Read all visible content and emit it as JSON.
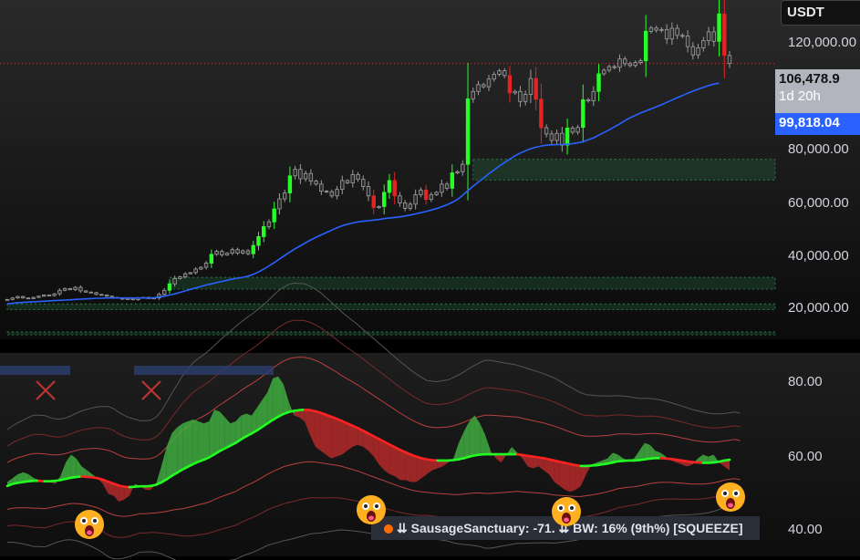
{
  "currency_label": "USDT",
  "price_tag": {
    "price": "106,478.9",
    "timer": "1d 20h"
  },
  "ma_tag": {
    "value": "99,818.04"
  },
  "legend": {
    "text": "⇊ SausageSanctuary: -71.  ⇊ BW: 16% (9th%) [SQUEEZE]"
  },
  "colors": {
    "bull_candle": "#26ff26",
    "bear_candle": "#e52323",
    "neutral_candle": "#9e9e9e",
    "blue_candle": "#2140d8",
    "ma_line": "#2962ff",
    "osc_up": "#3fae3f",
    "osc_down": "#b52a2a",
    "signal_up": "#22ff22",
    "signal_down": "#ff2222"
  },
  "chart_data": [
    {
      "type": "candlestick",
      "y_axis": {
        "ticks": [
          "120,000.00",
          "80,000.00",
          "60,000.00",
          "40,000.00",
          "20,000.00"
        ],
        "tick_values": [
          120000,
          80000,
          60000,
          40000,
          20000
        ],
        "range": [
          13000,
          128000
        ]
      },
      "current_price": 106478.9,
      "moving_average_last": 99818.04,
      "close_series": [
        26500,
        27000,
        27500,
        27000,
        26800,
        27200,
        27600,
        28000,
        27800,
        28400,
        29600,
        30200,
        29800,
        30600,
        29400,
        29000,
        28800,
        28200,
        28000,
        27600,
        27200,
        27000,
        26600,
        26800,
        26400,
        27000,
        27200,
        26800,
        27000,
        28200,
        29600,
        31800,
        33600,
        34200,
        35200,
        35600,
        36800,
        37400,
        38800,
        41800,
        42800,
        41600,
        42200,
        43400,
        42200,
        43000,
        42000,
        44800,
        47800,
        51200,
        52800,
        57200,
        60600,
        62600,
        68400,
        70600,
        67400,
        69200,
        66600,
        65600,
        63200,
        63000,
        61600,
        63800,
        66800,
        66000,
        68800,
        67200,
        64800,
        61600,
        57600,
        58000,
        62800,
        66800,
        61600,
        59200,
        57400,
        58800,
        62000,
        63600,
        60400,
        62000,
        62800,
        65600,
        64200,
        69400,
        69800,
        72300,
        94500,
        97000,
        99300,
        98600,
        101200,
        102800,
        104000,
        102400,
        96500,
        97000,
        93600,
        96000,
        101400,
        94400,
        84700,
        82600,
        80400,
        82800,
        78800,
        84600,
        83200,
        84800,
        94200,
        93800,
        97000,
        103000,
        104200,
        105400,
        105200,
        108000,
        106400,
        105800,
        106800,
        107400,
        117400,
        118500,
        117800,
        118000,
        114800,
        118400,
        116000,
        115800,
        112200,
        109400,
        111800,
        114200,
        117200,
        114000,
        123300,
        109200,
        106478.9
      ],
      "ma_series": [
        25000,
        25200,
        25400,
        25500,
        25600,
        25700,
        25800,
        25900,
        26000,
        26100,
        26200,
        26300,
        26400,
        26500,
        26600,
        26700,
        26800,
        26900,
        26900,
        27000,
        27000,
        27000,
        27000,
        27000,
        27000,
        27000,
        27000,
        27000,
        27100,
        27300,
        27600,
        28000,
        28400,
        28900,
        29400,
        29900,
        30400,
        30900,
        31400,
        31800,
        32200,
        32600,
        33000,
        33400,
        33700,
        34000,
        34400,
        35000,
        35800,
        36800,
        37900,
        39000,
        40200,
        41400,
        42600,
        43700,
        44700,
        45700,
        46700,
        47600,
        48400,
        49200,
        50000,
        50800,
        51500,
        52000,
        52400,
        52800,
        53000,
        53200,
        53400,
        53600,
        53900,
        54100,
        54300,
        54500,
        54800,
        55100,
        55500,
        55900,
        56300,
        56800,
        57300,
        57900,
        58600,
        59400,
        60400,
        61800,
        63400,
        64900,
        66300,
        67700,
        69100,
        70400,
        71700,
        72900,
        74100,
        75200,
        76100,
        76900,
        77600,
        78100,
        78500,
        78800,
        78900,
        79000,
        79000,
        79100,
        79300,
        79600,
        80000,
        80600,
        81300,
        82200,
        83100,
        84000,
        85000,
        86000,
        87100,
        88100,
        88900,
        89700,
        90400,
        91100,
        91800,
        92500,
        93300,
        94100,
        94900,
        95600,
        96400,
        97100,
        97800,
        98400,
        99000,
        99500,
        99818.04
      ],
      "zones": [
        {
          "low": 67000,
          "high": 74000,
          "from_index": 89
        },
        {
          "low": 30000,
          "high": 34000,
          "from_index": 31
        },
        {
          "low": 23000,
          "high": 25000,
          "from_index": 0
        },
        {
          "low": 14500,
          "high": 15500,
          "from_index": 0
        }
      ]
    },
    {
      "type": "area",
      "y_axis": {
        "ticks": [
          "80.00",
          "60.00",
          "40.00"
        ],
        "tick_values": [
          80,
          60,
          40
        ],
        "range": [
          36,
          88
        ]
      },
      "oscillator": [
        55,
        56,
        57,
        57.5,
        57,
        56,
        55.5,
        55,
        55,
        54.5,
        56.5,
        60,
        62,
        61,
        59,
        58,
        57,
        56,
        54.5,
        52,
        51.5,
        50,
        50.5,
        51.5,
        54.5,
        54,
        53,
        53,
        54.5,
        59,
        64,
        67.5,
        69,
        70,
        70.5,
        71,
        70.5,
        70,
        70.5,
        73.5,
        73,
        71.5,
        70,
        70.5,
        72,
        72.5,
        72,
        74,
        76,
        78,
        81.5,
        82,
        80,
        75.5,
        72,
        71.5,
        70.5,
        67,
        64,
        63,
        62,
        61,
        61.5,
        62,
        63,
        64,
        64.5,
        64,
        63,
        61.5,
        59.5,
        58,
        57,
        56.5,
        55.5,
        55.5,
        55,
        55,
        56,
        57,
        58,
        58.5,
        59,
        60,
        61,
        65,
        68,
        70.5,
        72,
        70,
        67,
        63,
        61,
        60,
        62,
        64,
        62.5,
        61,
        59,
        58.5,
        59,
        58,
        57,
        55,
        54,
        53,
        52.5,
        53,
        54,
        57,
        59.5,
        60,
        60.5,
        61,
        62.5,
        62,
        61,
        60.5,
        61,
        63,
        65,
        64.5,
        63,
        62.5,
        61.5,
        60.5,
        60,
        59.5,
        59,
        59.5,
        61,
        62,
        61.5,
        62,
        60,
        59,
        58
      ],
      "signal": [
        54,
        54.5,
        54.8,
        55,
        55.2,
        55.3,
        55.3,
        55.2,
        55.2,
        55.3,
        55.5,
        55.8,
        56.1,
        56.3,
        56.4,
        56.3,
        56.2,
        56,
        55.6,
        55.1,
        54.6,
        54.1,
        53.8,
        53.7,
        53.8,
        53.9,
        53.9,
        54,
        54.3,
        54.9,
        55.7,
        56.6,
        57.4,
        58.2,
        58.9,
        59.6,
        60.2,
        60.7,
        61.3,
        62.1,
        62.9,
        63.6,
        64.3,
        65,
        65.9,
        66.7,
        67.4,
        68.2,
        69.1,
        70,
        70.9,
        71.7,
        72.4,
        72.9,
        73.2,
        73.4,
        73.5,
        73.4,
        73.1,
        72.7,
        72.2,
        71.7,
        71.2,
        70.6,
        70,
        69.4,
        68.8,
        68.1,
        67.4,
        66.7,
        66,
        65.3,
        64.6,
        63.9,
        63.2,
        62.6,
        62,
        61.5,
        61.1,
        60.8,
        60.6,
        60.5,
        60.5,
        60.5,
        60.6,
        60.8,
        61.1,
        61.5,
        61.8,
        62,
        62.1,
        62.1,
        62.1,
        62.1,
        62.1,
        62.1,
        62.1,
        61.9,
        61.7,
        61.5,
        61.3,
        61.1,
        60.8,
        60.5,
        60.2,
        59.9,
        59.6,
        59.3,
        59.1,
        59.1,
        59.2,
        59.3,
        59.5,
        59.7,
        60,
        60.3,
        60.4,
        60.5,
        60.5,
        60.6,
        60.8,
        61,
        61.1,
        61.1,
        61,
        60.9,
        60.7,
        60.5,
        60.3,
        60.1,
        60,
        59.9,
        59.9,
        60,
        60.2,
        60.5,
        60.7,
        60.9,
        60.6
      ],
      "band_half_width": [
        6,
        6.2,
        6.4,
        6.6,
        6.8,
        7,
        7,
        7,
        6.8,
        6.6,
        6.5,
        6.5,
        6.6,
        6.8,
        7,
        7.2,
        7.4,
        7.6,
        7.8,
        8,
        8,
        7.8,
        7.6,
        7.4,
        7.2,
        7,
        7,
        7,
        7.2,
        7.6,
        8.2,
        8.8,
        9.4,
        10,
        10.4,
        10.8,
        11,
        11.2,
        11.4,
        11.6,
        11.8,
        12,
        12.2,
        12.4,
        12.5,
        12.6,
        12.7,
        12.8,
        12.9,
        13,
        13.2,
        13.4,
        13.5,
        13.6,
        13.6,
        13.5,
        13.4,
        13.2,
        13,
        12.8,
        12.5,
        12.2,
        11.9,
        11.6,
        11.4,
        11.2,
        11,
        10.8,
        10.6,
        10.4,
        10.2,
        10,
        9.8,
        9.6,
        9.4,
        9.2,
        9,
        8.8,
        8.6,
        8.4,
        8.4,
        8.4,
        8.5,
        8.6,
        8.8,
        9,
        9.2,
        9.4,
        9.6,
        9.8,
        10,
        10,
        9.9,
        9.8,
        9.7,
        9.6,
        9.5,
        9.4,
        9.3,
        9.2,
        9.1,
        9,
        8.9,
        8.8,
        8.6,
        8.4,
        8.2,
        8,
        7.8,
        7.6,
        7.5,
        7.4,
        7.3,
        7.2,
        7.1,
        7,
        6.9,
        6.8,
        6.7,
        6.6,
        6.5,
        6.4,
        6.3,
        6.2,
        6.1,
        6,
        5.9,
        5.8,
        5.7,
        5.6,
        5.5,
        5.4,
        5.3,
        5.2,
        5.1,
        5,
        5,
        5,
        5
      ]
    }
  ]
}
